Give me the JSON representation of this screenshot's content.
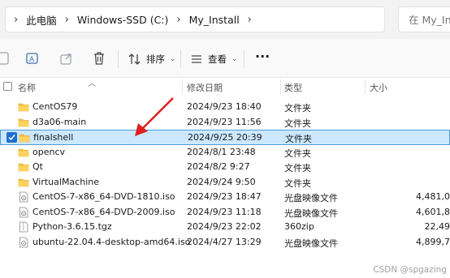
{
  "address_bar": {
    "breadcrumbs": [
      "此电脑",
      "Windows-SSD (C:)",
      "My_Install"
    ],
    "search_placeholder": "在 My_Install 中搜索"
  },
  "toolbar": {
    "sort_label": "排序",
    "view_label": "查看",
    "more_label": "···"
  },
  "columns": {
    "name": "名称",
    "date": "修改日期",
    "type": "类型",
    "size": "大小"
  },
  "files": [
    {
      "name": "CentOS79",
      "date": "2024/9/23 18:40",
      "type": "文件夹",
      "size": "",
      "icon": "folder-icon"
    },
    {
      "name": "d3a06-main",
      "date": "2024/9/23 11:56",
      "type": "文件夹",
      "size": "",
      "icon": "folder-icon"
    },
    {
      "name": "finalshell",
      "date": "2024/9/25 20:39",
      "type": "文件夹",
      "size": "",
      "icon": "folder-icon",
      "selected": true
    },
    {
      "name": "opencv",
      "date": "2024/8/1 23:48",
      "type": "文件夹",
      "size": "",
      "icon": "folder-icon"
    },
    {
      "name": "Qt",
      "date": "2024/8/2 9:27",
      "type": "文件夹",
      "size": "",
      "icon": "folder-icon"
    },
    {
      "name": "VirtualMachine",
      "date": "2024/9/24 9:50",
      "type": "文件夹",
      "size": "",
      "icon": "folder-icon"
    },
    {
      "name": "CentOS-7-x86_64-DVD-1810.iso",
      "date": "2024/9/23 18:47",
      "type": "光盘映像文件",
      "size": "4,481,0",
      "icon": "disc-image-icon"
    },
    {
      "name": "CentOS-7-x86_64-DVD-2009.iso",
      "date": "2024/9/23 11:18",
      "type": "光盘映像文件",
      "size": "4,601,8",
      "icon": "disc-image-icon"
    },
    {
      "name": "Python-3.6.15.tgz",
      "date": "2024/9/23 22:02",
      "type": "360zip",
      "size": "22,49",
      "icon": "archive-icon"
    },
    {
      "name": "ubuntu-22.04.4-desktop-amd64.iso",
      "date": "2024/4/27 13:29",
      "type": "光盘映像文件",
      "size": "4,899,7",
      "icon": "disc-image-icon"
    }
  ],
  "watermark": "CSDN @spgazing",
  "colors": {
    "folder": "#f5c342",
    "selection_bg": "#cce8ff",
    "selection_border": "#4d9ad8",
    "checkbox": "#1f6fd1",
    "annotation_arrow": "#e02020"
  }
}
